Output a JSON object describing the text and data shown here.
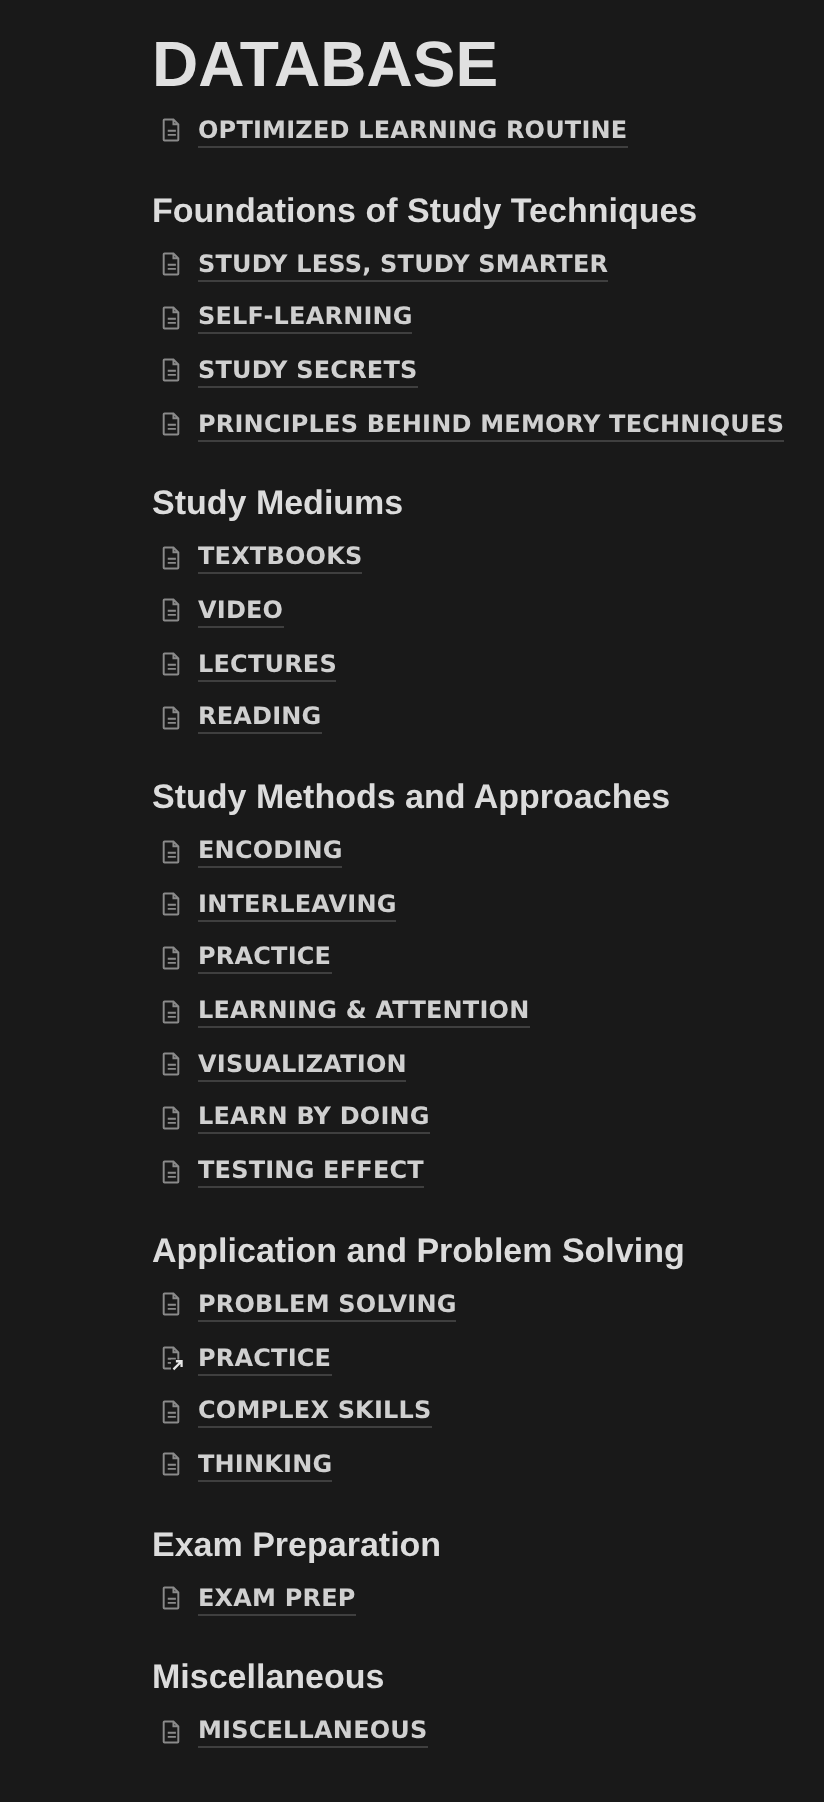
{
  "title": "DATABASE",
  "top_links": [
    {
      "label": "OPTIMIZED LEARNING ROUTINE",
      "kind": "page"
    }
  ],
  "sections": [
    {
      "heading": "Foundations of Study Techniques",
      "links": [
        {
          "label": "STUDY LESS, STUDY SMARTER",
          "kind": "page"
        },
        {
          "label": "SELF-LEARNING",
          "kind": "page"
        },
        {
          "label": "STUDY SECRETS",
          "kind": "page"
        },
        {
          "label": "PRINCIPLES BEHIND MEMORY TECHNIQUES",
          "kind": "page"
        }
      ]
    },
    {
      "heading": "Study Mediums",
      "links": [
        {
          "label": "TEXTBOOKS",
          "kind": "page"
        },
        {
          "label": "VIDEO",
          "kind": "page"
        },
        {
          "label": "LECTURES",
          "kind": "page"
        },
        {
          "label": "READING",
          "kind": "page"
        }
      ]
    },
    {
      "heading": "Study Methods and Approaches",
      "links": [
        {
          "label": "ENCODING",
          "kind": "page"
        },
        {
          "label": "INTERLEAVING",
          "kind": "page"
        },
        {
          "label": "PRACTICE",
          "kind": "page"
        },
        {
          "label": "LEARNING & ATTENTION",
          "kind": "page"
        },
        {
          "label": "VISUALIZATION",
          "kind": "page"
        },
        {
          "label": "LEARN BY DOING",
          "kind": "page"
        },
        {
          "label": "TESTING EFFECT",
          "kind": "page"
        }
      ]
    },
    {
      "heading": "Application and Problem Solving",
      "links": [
        {
          "label": "PROBLEM SOLVING",
          "kind": "page"
        },
        {
          "label": "PRACTICE",
          "kind": "alias"
        },
        {
          "label": "COMPLEX SKILLS",
          "kind": "page"
        },
        {
          "label": "THINKING",
          "kind": "page"
        }
      ]
    },
    {
      "heading": "Exam Preparation",
      "links": [
        {
          "label": "EXAM PREP",
          "kind": "page"
        }
      ]
    },
    {
      "heading": "Miscellaneous",
      "links": [
        {
          "label": "MISCELLANEOUS",
          "kind": "page"
        }
      ]
    }
  ]
}
